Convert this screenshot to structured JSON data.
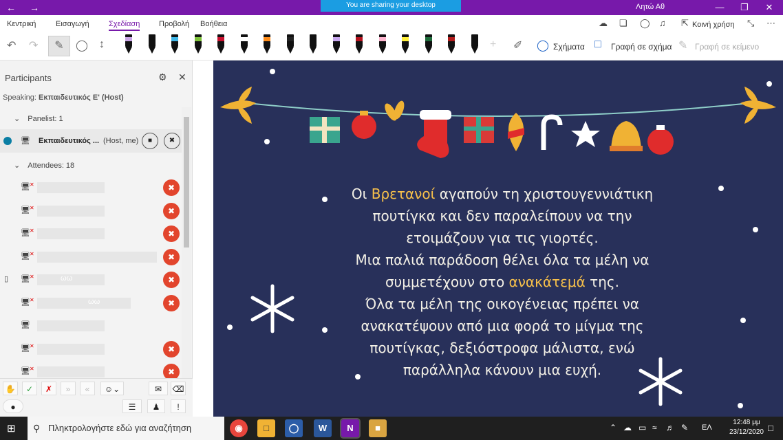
{
  "titlebar": {
    "sharing_banner": "You are sharing your desktop",
    "user_name": "Λητώ Αθ",
    "back_icon": "arrow-left-icon",
    "forward_icon": "arrow-right-icon"
  },
  "ribbon": {
    "tabs": [
      "Κεντρική",
      "Εισαγωγή",
      "Σχεδίαση",
      "Προβολή",
      "Βοήθεια"
    ],
    "active_tab": "Σχεδίαση",
    "share_label": "Κοινή χρήση"
  },
  "toolbar": {
    "shapes_label": "Σχήματα",
    "ink_to_shape_label": "Γραφή σε σχήμα",
    "ink_to_text_label": "Γραφή σε κείμενο",
    "pen_colors": [
      "#c9a4e6",
      "#111111",
      "#3fb6e6",
      "#7ec23a",
      "#c8102e",
      "#ffffff",
      "#ff8c1a",
      "#222222",
      "#111111",
      "#c9a8f0",
      "#b4121e",
      "#ffb6d0",
      "#fff03a",
      "#1e6b3a",
      "#b31b1b",
      "#111111"
    ]
  },
  "participants": {
    "title": "Participants",
    "speaking_prefix": "Speaking:",
    "speaking_name": "Εκπαιδευτικός Ε'  (Host)",
    "panelist_label": "Panelist: 1",
    "host_name": "Εκπαιδευτικός ...",
    "host_tag": "(Host, me)",
    "attendees_label": "Attendees: 18",
    "attendee_rows": [
      {
        "muted": true
      },
      {
        "muted": true
      },
      {
        "muted": true
      },
      {
        "muted": true
      },
      {
        "muted": true,
        "device": "mobile",
        "blurred_text": "ωω"
      },
      {
        "muted": true,
        "blurred_text": "ωω"
      },
      {
        "muted": false
      },
      {
        "muted": true
      },
      {
        "muted": true
      }
    ]
  },
  "slide": {
    "line1_a": "Οι ",
    "line1_hl": "Βρετανοί",
    "line1_b": " αγαπούν τη χριστουγεννιάτικη",
    "line2": "πουτίγκα και δεν παραλείπουν να την",
    "line3": "ετοιμάζουν για τις γιορτές.",
    "line4": "Μια παλιά παράδοση θέλει όλα τα μέλη να",
    "line5_a": "συμμετέχουν στο ",
    "line5_hl": "ανακάτεμά",
    "line5_b": " της.",
    "line6": "Όλα τα μέλη της οικογένειας πρέπει να",
    "line7": "ανακατέψουν από μια φορά το μίγμα της",
    "line8": "πουτίγκας, δεξιόστροφα μάλιστα, ενώ",
    "line9": "παράλληλα κάνουν μια ευχή."
  },
  "taskbar": {
    "search_placeholder": "Πληκτρολογήστε εδώ για αναζήτηση",
    "language": "ΕΛ",
    "time": "12:48 μμ",
    "date": "23/12/2020"
  }
}
